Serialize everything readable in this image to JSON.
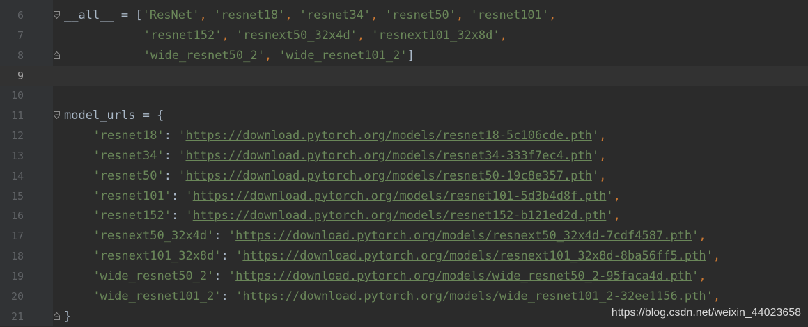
{
  "editor": {
    "lines": [
      {
        "number": "6",
        "fold": "open",
        "indent": 0,
        "parts": [
          {
            "t": "__all__",
            "c": "pl"
          },
          {
            "t": " = [",
            "c": "pl"
          },
          {
            "t": "'ResNet'",
            "c": "str"
          },
          {
            "t": ", ",
            "c": "op"
          },
          {
            "t": "'resnet18'",
            "c": "str"
          },
          {
            "t": ", ",
            "c": "op"
          },
          {
            "t": "'resnet34'",
            "c": "str"
          },
          {
            "t": ", ",
            "c": "op"
          },
          {
            "t": "'resnet50'",
            "c": "str"
          },
          {
            "t": ", ",
            "c": "op"
          },
          {
            "t": "'resnet101'",
            "c": "str"
          },
          {
            "t": ",",
            "c": "op"
          }
        ]
      },
      {
        "number": "7",
        "indent": 11,
        "parts": [
          {
            "t": "'resnet152'",
            "c": "str"
          },
          {
            "t": ", ",
            "c": "op"
          },
          {
            "t": "'resnext50_32x4d'",
            "c": "str"
          },
          {
            "t": ", ",
            "c": "op"
          },
          {
            "t": "'resnext101_32x8d'",
            "c": "str"
          },
          {
            "t": ",",
            "c": "op"
          }
        ]
      },
      {
        "number": "8",
        "fold": "close",
        "indent": 11,
        "parts": [
          {
            "t": "'wide_resnet50_2'",
            "c": "str"
          },
          {
            "t": ", ",
            "c": "op"
          },
          {
            "t": "'wide_resnet101_2'",
            "c": "str"
          },
          {
            "t": "]",
            "c": "pl"
          }
        ]
      },
      {
        "number": "9",
        "current": true,
        "parts": []
      },
      {
        "number": "10",
        "parts": []
      },
      {
        "number": "11",
        "fold": "open",
        "indent": 0,
        "parts": [
          {
            "t": "model_urls = {",
            "c": "pl"
          }
        ]
      },
      {
        "number": "12",
        "indent": 4,
        "parts": [
          {
            "t": "'resnet18'",
            "c": "str"
          },
          {
            "t": ": ",
            "c": "pl"
          },
          {
            "t": "'",
            "c": "str"
          },
          {
            "t": "https://download.pytorch.org/models/resnet18-5c106cde.pth",
            "c": "url"
          },
          {
            "t": "'",
            "c": "str"
          },
          {
            "t": ",",
            "c": "op"
          }
        ]
      },
      {
        "number": "13",
        "indent": 4,
        "parts": [
          {
            "t": "'resnet34'",
            "c": "str"
          },
          {
            "t": ": ",
            "c": "pl"
          },
          {
            "t": "'",
            "c": "str"
          },
          {
            "t": "https://download.pytorch.org/models/resnet34-333f7ec4.pth",
            "c": "url"
          },
          {
            "t": "'",
            "c": "str"
          },
          {
            "t": ",",
            "c": "op"
          }
        ]
      },
      {
        "number": "14",
        "indent": 4,
        "parts": [
          {
            "t": "'resnet50'",
            "c": "str"
          },
          {
            "t": ": ",
            "c": "pl"
          },
          {
            "t": "'",
            "c": "str"
          },
          {
            "t": "https://download.pytorch.org/models/resnet50-19c8e357.pth",
            "c": "url"
          },
          {
            "t": "'",
            "c": "str"
          },
          {
            "t": ",",
            "c": "op"
          }
        ]
      },
      {
        "number": "15",
        "indent": 4,
        "parts": [
          {
            "t": "'resnet101'",
            "c": "str"
          },
          {
            "t": ": ",
            "c": "pl"
          },
          {
            "t": "'",
            "c": "str"
          },
          {
            "t": "https://download.pytorch.org/models/resnet101-5d3b4d8f.pth",
            "c": "url"
          },
          {
            "t": "'",
            "c": "str"
          },
          {
            "t": ",",
            "c": "op"
          }
        ]
      },
      {
        "number": "16",
        "indent": 4,
        "parts": [
          {
            "t": "'resnet152'",
            "c": "str"
          },
          {
            "t": ": ",
            "c": "pl"
          },
          {
            "t": "'",
            "c": "str"
          },
          {
            "t": "https://download.pytorch.org/models/resnet152-b121ed2d.pth",
            "c": "url"
          },
          {
            "t": "'",
            "c": "str"
          },
          {
            "t": ",",
            "c": "op"
          }
        ]
      },
      {
        "number": "17",
        "indent": 4,
        "parts": [
          {
            "t": "'resnext50_32x4d'",
            "c": "str"
          },
          {
            "t": ": ",
            "c": "pl"
          },
          {
            "t": "'",
            "c": "str"
          },
          {
            "t": "https://download.pytorch.org/models/resnext50_32x4d-7cdf4587.pth",
            "c": "url"
          },
          {
            "t": "'",
            "c": "str"
          },
          {
            "t": ",",
            "c": "op"
          }
        ]
      },
      {
        "number": "18",
        "indent": 4,
        "parts": [
          {
            "t": "'resnext101_32x8d'",
            "c": "str"
          },
          {
            "t": ": ",
            "c": "pl"
          },
          {
            "t": "'",
            "c": "str"
          },
          {
            "t": "https://download.pytorch.org/models/resnext101_32x8d-8ba56ff5.pth",
            "c": "url"
          },
          {
            "t": "'",
            "c": "str"
          },
          {
            "t": ",",
            "c": "op"
          }
        ]
      },
      {
        "number": "19",
        "indent": 4,
        "parts": [
          {
            "t": "'wide_resnet50_2'",
            "c": "str"
          },
          {
            "t": ": ",
            "c": "pl"
          },
          {
            "t": "'",
            "c": "str"
          },
          {
            "t": "https://download.pytorch.org/models/wide_resnet50_2-95faca4d.pth",
            "c": "url"
          },
          {
            "t": "'",
            "c": "str"
          },
          {
            "t": ",",
            "c": "op"
          }
        ]
      },
      {
        "number": "20",
        "indent": 4,
        "parts": [
          {
            "t": "'wide_resnet101_2'",
            "c": "str"
          },
          {
            "t": ": ",
            "c": "pl"
          },
          {
            "t": "'",
            "c": "str"
          },
          {
            "t": "https://download.pytorch.org/models/wide_resnet101_2-32ee1156.pth",
            "c": "url"
          },
          {
            "t": "'",
            "c": "str"
          },
          {
            "t": ",",
            "c": "op"
          }
        ]
      },
      {
        "number": "21",
        "fold": "close",
        "indent": 0,
        "parts": [
          {
            "t": "}",
            "c": "pl"
          }
        ]
      }
    ]
  },
  "watermark": "https://blog.csdn.net/weixin_44023658",
  "colors": {
    "background": "#2b2b2b",
    "gutter": "#313335",
    "line_number": "#606366",
    "text": "#a9b7c6",
    "string": "#6a8759",
    "keyword": "#cc7832",
    "current_line": "#323232"
  },
  "icons": {
    "fold_open": "fold-open-icon",
    "fold_close": "fold-close-icon"
  }
}
